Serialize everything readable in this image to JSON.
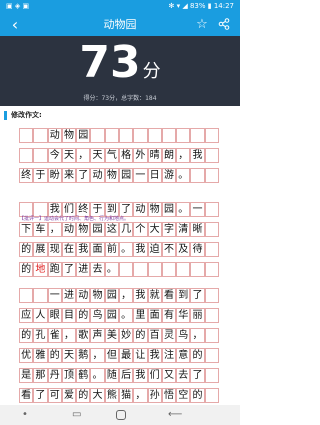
{
  "status": {
    "left": "▣ ◈ ▣",
    "right": "✻ ▾ ◢ 83% ▮ 14:27"
  },
  "app_bar": {
    "title": "动物园",
    "back_icon": "back-arrow-icon",
    "star_icon": "star-icon",
    "share_icon": "share-icon"
  },
  "score": {
    "value": "73",
    "unit": "分",
    "meta": "得分：73分，总字数：184"
  },
  "section": {
    "title": "修改作文:"
  },
  "comment": "【批评一】运动会代了时间、角色、行为和地点。",
  "rows": [
    [
      "",
      "",
      "动",
      "物",
      "园",
      "",
      "",
      "",
      "",
      "",
      "",
      "",
      "",
      ""
    ],
    [
      "",
      "",
      "今",
      "天",
      "，",
      "天",
      "气",
      "格",
      "外",
      "晴",
      "朗",
      "，",
      "我",
      ""
    ],
    [
      "终",
      "于",
      "盼",
      "来",
      "了",
      "动",
      "物",
      "园",
      "一",
      "日",
      "游",
      "。",
      "",
      ""
    ],
    [
      "",
      "",
      "我",
      "们",
      "终",
      "于",
      "到",
      "了",
      "动",
      "物",
      "园",
      "。",
      "一",
      ""
    ],
    [
      "下",
      "车",
      "，",
      "动",
      "物",
      "园",
      "这",
      "几",
      "个",
      "大",
      "字",
      "清",
      "晰",
      ""
    ],
    [
      "的",
      "展",
      "现",
      "在",
      "我",
      "面",
      "前",
      "。",
      "我",
      "迫",
      "不",
      "及",
      "待",
      ""
    ],
    [
      "的",
      "地",
      "跑",
      "了",
      "进",
      "去",
      "。",
      "",
      "",
      "",
      "",
      "",
      "",
      ""
    ],
    [
      "",
      "",
      "一",
      "进",
      "动",
      "物",
      "园",
      "，",
      "我",
      "就",
      "看",
      "到",
      "了",
      ""
    ],
    [
      "应",
      "人",
      "眼",
      "目",
      "的",
      "鸟",
      "园",
      "。",
      "里",
      "面",
      "有",
      "华",
      "丽",
      ""
    ],
    [
      "的",
      "孔",
      "雀",
      "，",
      "歌",
      "声",
      "美",
      "妙",
      "的",
      "百",
      "灵",
      "鸟",
      "，",
      ""
    ],
    [
      "优",
      "雅",
      "的",
      "天",
      "鹅",
      "，",
      "但",
      "最",
      "让",
      "我",
      "注",
      "意",
      "的",
      ""
    ],
    [
      "是",
      "那",
      "丹",
      "顶",
      "鹤",
      "。",
      "随",
      "后",
      "我",
      "们",
      "又",
      "去",
      "了",
      ""
    ],
    [
      "看",
      "了",
      "可",
      "爱",
      "的",
      "大",
      "熊",
      "猫",
      "，",
      "孙",
      "悟",
      "空",
      "的",
      ""
    ]
  ],
  "nav": {
    "dot": "•",
    "recent": "▭",
    "back": "⟵"
  }
}
